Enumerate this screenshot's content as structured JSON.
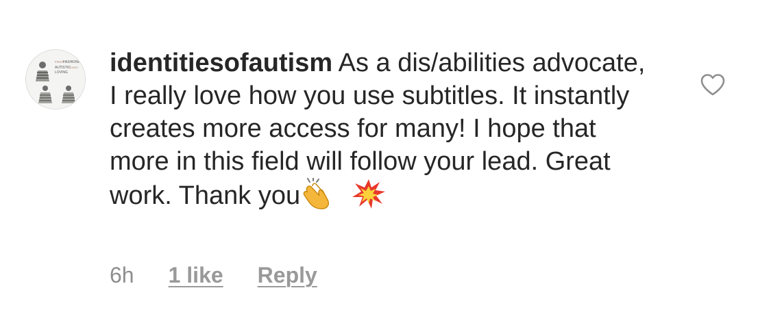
{
  "comment": {
    "username": "identitiesofautism",
    "text": "As a dis/abilities advocate, I really love how you use subtitles. It instantly creates more access for many! I hope that more in this field will follow your lead. Great work. Thank you",
    "emojis": [
      "clapping-hands-emoji",
      "collision-emoji"
    ],
    "timestamp": "6h",
    "likes_label": "1 like",
    "reply_label": "Reply",
    "like_icon": "heart-outline-icon"
  },
  "avatar": {
    "line1_left": "FIRST",
    "line1_right": "FASHIONA",
    "line2_left": "AUTISTIC",
    "line2_right": "SOMEO",
    "line3": "LOVING"
  },
  "colors": {
    "text": "#262626",
    "meta": "#8e8e8e",
    "icon_stroke": "#8e8e8e"
  }
}
